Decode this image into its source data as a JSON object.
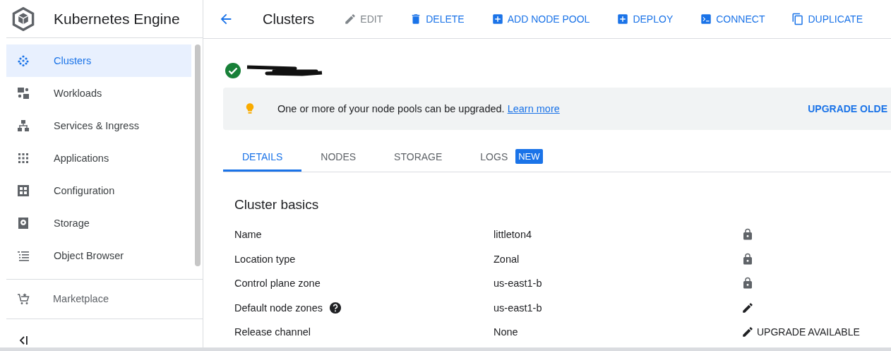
{
  "sidebar": {
    "title": "Kubernetes Engine",
    "items": [
      {
        "label": "Clusters",
        "selected": true
      },
      {
        "label": "Workloads",
        "selected": false
      },
      {
        "label": "Services & Ingress",
        "selected": false
      },
      {
        "label": "Applications",
        "selected": false
      },
      {
        "label": "Configuration",
        "selected": false
      },
      {
        "label": "Storage",
        "selected": false
      },
      {
        "label": "Object Browser",
        "selected": false
      }
    ],
    "footer_item": {
      "label": "Marketplace"
    }
  },
  "header": {
    "title": "Clusters",
    "actions": [
      {
        "label": "EDIT",
        "kind": "edit",
        "disabled": true
      },
      {
        "label": "DELETE",
        "kind": "delete",
        "disabled": false
      },
      {
        "label": "ADD NODE POOL",
        "kind": "add",
        "disabled": false
      },
      {
        "label": "DEPLOY",
        "kind": "add",
        "disabled": false
      },
      {
        "label": "CONNECT",
        "kind": "terminal",
        "disabled": false
      },
      {
        "label": "DUPLICATE",
        "kind": "copy",
        "disabled": false
      }
    ]
  },
  "cluster": {
    "healthy": true,
    "name_redacted": true
  },
  "banner": {
    "text": "One or more of your node pools can be upgraded.",
    "link": "Learn more",
    "action": "UPGRADE OLDE"
  },
  "tabs": [
    {
      "label": "DETAILS",
      "selected": true
    },
    {
      "label": "NODES",
      "selected": false
    },
    {
      "label": "STORAGE",
      "selected": false
    },
    {
      "label": "LOGS",
      "selected": false,
      "badge": "NEW"
    }
  ],
  "section": {
    "title": "Cluster basics",
    "rows": [
      {
        "label": "Name",
        "value": "littleton4",
        "help": false,
        "kind": "lock"
      },
      {
        "label": "Location type",
        "value": "Zonal",
        "help": false,
        "kind": "lock"
      },
      {
        "label": "Control plane zone",
        "value": "us-east1-b",
        "help": false,
        "kind": "lock"
      },
      {
        "label": "Default node zones",
        "value": "us-east1-b",
        "help": true,
        "kind": "edit"
      },
      {
        "label": "Release channel",
        "value": "None",
        "help": false,
        "kind": "edit",
        "action_label": "UPGRADE AVAILABLE"
      }
    ]
  }
}
